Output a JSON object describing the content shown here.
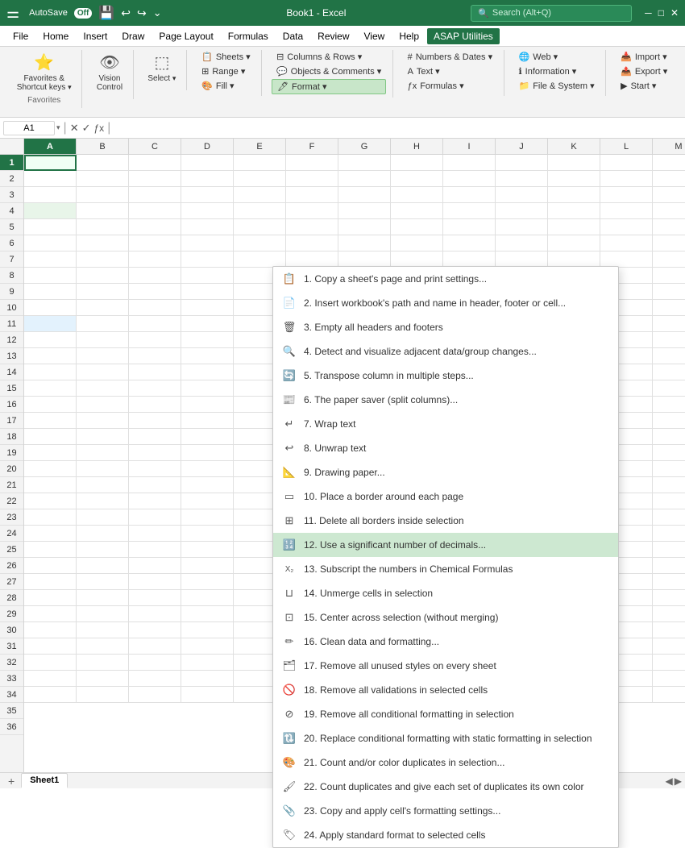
{
  "titlebar": {
    "logo": "X",
    "autosave": "AutoSave",
    "toggle": "Off",
    "filename": "Book1  -  Excel",
    "search_placeholder": "Search (Alt+Q)",
    "save_icon": "💾",
    "undo_icon": "↩",
    "redo_icon": "↪"
  },
  "menubar": {
    "items": [
      "File",
      "Home",
      "Insert",
      "Draw",
      "Page Layout",
      "Formulas",
      "Data",
      "Review",
      "View",
      "Help",
      "ASAP Utilities"
    ]
  },
  "ribbon": {
    "group_favorites": {
      "label": "Favorites",
      "btn1_label": "Favorites &\nShortcut keys",
      "btn1_arrow": "▾"
    },
    "group_vision": {
      "label": "",
      "btn1_label": "Vision\nControl"
    },
    "group_select": {
      "label": "",
      "btn1_label": "Select",
      "btn1_arrow": "▾"
    },
    "group_sheets": {
      "label": "",
      "rows": [
        {
          "label": "Sheets ▾",
          "type": "row"
        },
        {
          "label": "Range ▾",
          "type": "row"
        },
        {
          "label": "Fill ▾",
          "type": "row"
        }
      ]
    },
    "group_columns": {
      "label": "",
      "rows": [
        {
          "label": "Columns & Rows ▾"
        },
        {
          "label": "Objects & Comments ▾"
        },
        {
          "label": "Format ▾",
          "active": true
        }
      ]
    },
    "group_text": {
      "label": "",
      "rows": [
        {
          "label": "Numbers & Dates ▾"
        },
        {
          "label": "Text ▾"
        },
        {
          "label": "Formulas ▾"
        }
      ]
    },
    "group_web": {
      "label": "",
      "rows": [
        {
          "label": "Web ▾"
        },
        {
          "label": "Information ▾"
        },
        {
          "label": "File & System ▾"
        }
      ]
    },
    "group_import": {
      "label": "",
      "rows": [
        {
          "label": "Import ▾"
        },
        {
          "label": "Export ▾"
        },
        {
          "label": "Start ▾"
        }
      ]
    }
  },
  "formulabar": {
    "cell_ref": "A1",
    "formula": ""
  },
  "columns": [
    "A",
    "B",
    "C",
    "D",
    "E",
    "F",
    "G",
    "H",
    "I",
    "J",
    "K",
    "L",
    "M"
  ],
  "rows": [
    1,
    2,
    3,
    4,
    5,
    6,
    7,
    8,
    9,
    10,
    11,
    12,
    13,
    14,
    15,
    16,
    17,
    18,
    19,
    20,
    21,
    22,
    23,
    24,
    25,
    26,
    27,
    28,
    29,
    30,
    31,
    32,
    33,
    34,
    35,
    36
  ],
  "sheet_tabs": [
    "Sheet1"
  ],
  "dropdown": {
    "items": [
      {
        "icon": "📋",
        "text": "1.  Copy a sheet's page and print settings...",
        "highlighted": false
      },
      {
        "icon": "📄",
        "text": "2.  Insert workbook's path and name in header, footer or cell...",
        "highlighted": false
      },
      {
        "icon": "🗑️",
        "text": "3.  Empty all headers and footers",
        "highlighted": false
      },
      {
        "icon": "🔍",
        "text": "4.  Detect and visualize adjacent data/group changes...",
        "highlighted": false
      },
      {
        "icon": "🔄",
        "text": "5.  Transpose column in multiple steps...",
        "highlighted": false
      },
      {
        "icon": "📰",
        "text": "6.  The paper saver (split columns)...",
        "highlighted": false
      },
      {
        "icon": "↩",
        "text": "7.  Wrap text",
        "highlighted": false
      },
      {
        "icon": "↪",
        "text": "8.  Unwrap text",
        "highlighted": false
      },
      {
        "icon": "📐",
        "text": "9.  Drawing paper...",
        "highlighted": false
      },
      {
        "icon": "▭",
        "text": "10.  Place a border around each page",
        "highlighted": false
      },
      {
        "icon": "⊞",
        "text": "11.  Delete all borders inside selection",
        "highlighted": false
      },
      {
        "icon": "🔢",
        "text": "12.  Use a significant number of decimals...",
        "highlighted": true
      },
      {
        "icon": "x₂",
        "text": "13.  Subscript the numbers in Chemical Formulas",
        "highlighted": false
      },
      {
        "icon": "⊔",
        "text": "14.  Unmerge cells in selection",
        "highlighted": false
      },
      {
        "icon": "⊡",
        "text": "15.  Center across selection (without merging)",
        "highlighted": false
      },
      {
        "icon": "✏️",
        "text": "16.  Clean data and formatting...",
        "highlighted": false
      },
      {
        "icon": "🗂️",
        "text": "17.  Remove all unused styles on every sheet",
        "highlighted": false
      },
      {
        "icon": "🚫",
        "text": "18.  Remove all validations in selected cells",
        "highlighted": false
      },
      {
        "icon": "⊘",
        "text": "19.  Remove all conditional formatting in selection",
        "highlighted": false
      },
      {
        "icon": "🔃",
        "text": "20.  Replace conditional formatting with static formatting in selection",
        "highlighted": false
      },
      {
        "icon": "🎨",
        "text": "21.  Count and/or color duplicates in selection...",
        "highlighted": false
      },
      {
        "icon": "🖌️",
        "text": "22.  Count duplicates and give each set of duplicates its own color",
        "highlighted": false
      },
      {
        "icon": "📎",
        "text": "23.  Copy and apply cell's formatting settings...",
        "highlighted": false
      },
      {
        "icon": "🏷️",
        "text": "24.  Apply standard format to selected cells",
        "highlighted": false
      }
    ]
  }
}
